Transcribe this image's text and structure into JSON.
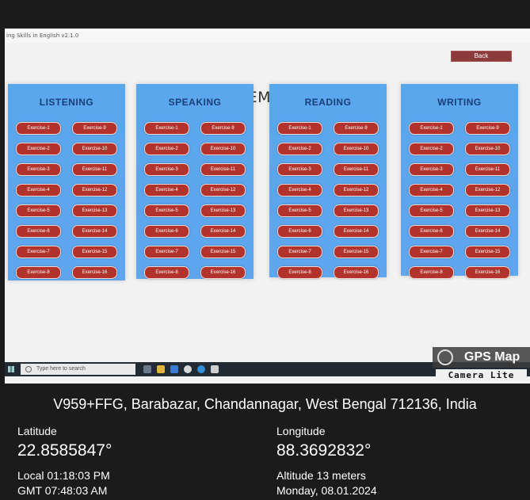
{
  "app": {
    "window_title": "ing Skills in English v2.1.0",
    "module_title": "MODULE 2: ELEMENTARY LEVEL",
    "back_label": "Back"
  },
  "panels": [
    {
      "title": "LISTENING",
      "exercises": [
        "Exercise-1",
        "Exercise-9",
        "Exercise-2",
        "Exercise-10",
        "Exercise-3",
        "Exercise-11",
        "Exercise-4",
        "Exercise-12",
        "Exercise-5",
        "Exercise-13",
        "Exercise-6",
        "Exercise-14",
        "Exercise-7",
        "Exercise-15",
        "Exercise-8",
        "Exercise-16"
      ]
    },
    {
      "title": "SPEAKING",
      "exercises": [
        "Exercise-1",
        "Exercise-9",
        "Exercise-2",
        "Exercise-10",
        "Exercise-3",
        "Exercise-11",
        "Exercise-4",
        "Exercise-12",
        "Exercise-5",
        "Exercise-13",
        "Exercise-6",
        "Exercise-14",
        "Exercise-7",
        "Exercise-15",
        "Exercise-8",
        "Exercise-16"
      ]
    },
    {
      "title": "READING",
      "exercises": [
        "Exercise-1",
        "Exercise-9",
        "Exercise-2",
        "Exercise-10",
        "Exercise-3",
        "Exercise-11",
        "Exercise-4",
        "Exercise-12",
        "Exercise-5",
        "Exercise-13",
        "Exercise-6",
        "Exercise-14",
        "Exercise-7",
        "Exercise-15",
        "Exercise-8",
        "Exercise-16"
      ]
    },
    {
      "title": "WRITING",
      "exercises": [
        "Exercise-1",
        "Exercise-9",
        "Exercise-2",
        "Exercise-10",
        "Exercise-3",
        "Exercise-11",
        "Exercise-4",
        "Exercise-12",
        "Exercise-5",
        "Exercise-13",
        "Exercise-6",
        "Exercise-14",
        "Exercise-7",
        "Exercise-15",
        "Exercise-8",
        "Exercise-16"
      ]
    }
  ],
  "taskbar": {
    "search_placeholder": "Type here to search",
    "icons": [
      "task-view-icon",
      "file-explorer-icon",
      "mail-icon",
      "chrome-icon",
      "edge-icon",
      "store-icon"
    ]
  },
  "gps": {
    "brand": "GPS Map",
    "sub": "Camera Lite",
    "address": "V959+FFG, Barabazar, Chandannagar, West Bengal 712136, India",
    "latitude_label": "Latitude",
    "latitude": "22.8585847°",
    "longitude_label": "Longitude",
    "longitude": "88.3692832°",
    "local_time": "Local 01:18:03 PM",
    "gmt_time": "GMT 07:48:03 AM",
    "altitude": "Altitude 13 meters",
    "date": "Monday, 08.01.2024"
  },
  "colors": {
    "panel_blue": "#5aa7ee",
    "button_red": "#b2332c",
    "title_dark_blue": "#1a3e78"
  }
}
